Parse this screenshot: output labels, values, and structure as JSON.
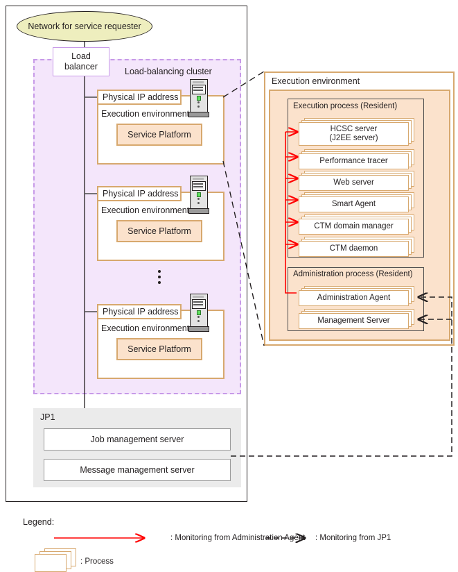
{
  "diagram": {
    "network": {
      "label": "Network for service requester"
    },
    "load_balancer": {
      "label": "Load\nbalancer",
      "line1": "Load",
      "line2": "balancer"
    },
    "cluster": {
      "label": "Load-balancing cluster",
      "nodes": [
        {
          "ip_label": "Physical IP address",
          "env_label": "Execution environment",
          "platform_label": "Service Platform"
        },
        {
          "ip_label": "Physical IP address",
          "env_label": "Execution environment",
          "platform_label": "Service Platform"
        },
        {
          "ip_label": "Physical IP address",
          "env_label": "Execution environment",
          "platform_label": "Service Platform"
        }
      ],
      "ellipsis": "⋮"
    },
    "jp1": {
      "label": "JP1",
      "servers": [
        {
          "label": "Job management server"
        },
        {
          "label": "Message management server"
        }
      ]
    },
    "detail": {
      "label": "Execution environment",
      "execution_process": {
        "label": "Execution process (Resident)",
        "items": [
          {
            "label": "HCSC server\n(J2EE server)",
            "line1": "HCSC server",
            "line2": "(J2EE server)"
          },
          {
            "label": "Performance tracer",
            "line1": "Performance tracer",
            "line2": ""
          },
          {
            "label": "Web server",
            "line1": "Web server",
            "line2": ""
          },
          {
            "label": "Smart Agent",
            "line1": "Smart Agent",
            "line2": ""
          },
          {
            "label": "CTM domain manager",
            "line1": "CTM domain manager",
            "line2": ""
          },
          {
            "label": "CTM daemon",
            "line1": "CTM daemon",
            "line2": ""
          }
        ]
      },
      "administration_process": {
        "label": "Administration process (Resident)",
        "items": [
          {
            "label": "Administration Agent",
            "line1": "Administration Agent",
            "line2": ""
          },
          {
            "label": "Management Server",
            "line1": "Management Server",
            "line2": ""
          }
        ]
      }
    },
    "legend": {
      "title": "Legend:",
      "entries": [
        {
          "text": ": Monitoring from Administration Agent",
          "symbol": "solid-red-arrow"
        },
        {
          "text": ": Monitoring from JP1",
          "symbol": "dashed-black-arrow"
        },
        {
          "text": ": Process",
          "symbol": "stacked-process-card"
        }
      ]
    },
    "colors": {
      "frame_border": "#231f20",
      "network_fill": "#eeeebe",
      "cluster_fill": "#f4e6fb",
      "cluster_border": "#c79ae8",
      "tan_border": "#d7a86e",
      "panel_fill": "#fbe2cc",
      "jp1_fill": "#ebebeb",
      "monitor_admin": "#ff0000",
      "monitor_jp1": "#231f20"
    }
  }
}
